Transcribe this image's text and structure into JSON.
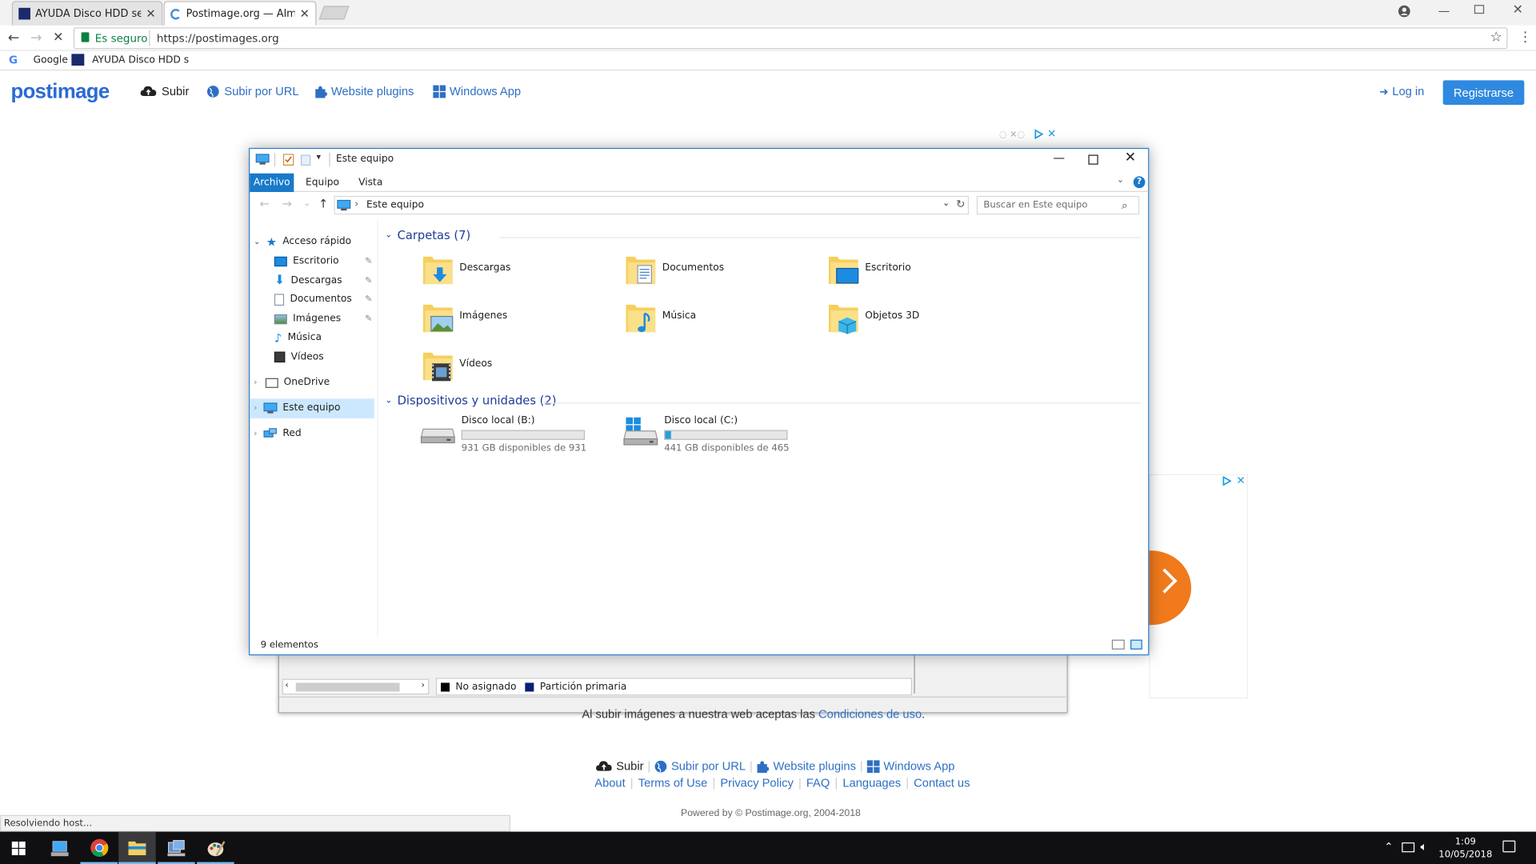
{
  "browser": {
    "tabs": [
      {
        "label": "AYUDA Disco HDD secun"
      },
      {
        "label": "Postimage.org — Almace"
      }
    ],
    "secure_label": "Es seguro",
    "url": "https://postimages.org",
    "bookmarks": [
      {
        "label": "Google"
      },
      {
        "label": "AYUDA Disco HDD s"
      }
    ],
    "status": "Resolviendo host..."
  },
  "site": {
    "logo": "postimage",
    "nav": [
      {
        "label": "Subir",
        "icon": "cloud-upload-icon"
      },
      {
        "label": "Subir por URL",
        "icon": "globe-icon"
      },
      {
        "label": "Website plugins",
        "icon": "puzzle-icon"
      },
      {
        "label": "Windows App",
        "icon": "windows-icon"
      }
    ],
    "login_label": "Log in",
    "register_label": "Registrarse",
    "terms_text": "Al subir imágenes a nuestra web aceptas las",
    "terms_link": "Condiciones de uso",
    "terms_end": ".",
    "footer_nav": [
      {
        "label": "Subir"
      },
      {
        "label": "Subir por URL"
      },
      {
        "label": "Website plugins"
      },
      {
        "label": "Windows App"
      }
    ],
    "footer_links": [
      {
        "label": "About"
      },
      {
        "label": "Terms of Use"
      },
      {
        "label": "Privacy Policy"
      },
      {
        "label": "FAQ"
      },
      {
        "label": "Languages"
      },
      {
        "label": "Contact us"
      }
    ],
    "powered": "Powered by © Postimage.org, 2004-2018"
  },
  "diskmgmt": {
    "legend": [
      {
        "label": "No asignado",
        "color": "#000000"
      },
      {
        "label": "Partición primaria",
        "color": "#0a1e78"
      }
    ]
  },
  "explorer": {
    "title": "Este equipo",
    "ribbon_tabs": [
      {
        "label": "Archivo"
      },
      {
        "label": "Equipo"
      },
      {
        "label": "Vista"
      }
    ],
    "address": "Este equipo",
    "search_placeholder": "Buscar en Este equipo",
    "nav": {
      "quick_access": "Acceso rápido",
      "pinned": [
        {
          "label": "Escritorio",
          "icon": "desktop-icon"
        },
        {
          "label": "Descargas",
          "icon": "download-icon"
        },
        {
          "label": "Documentos",
          "icon": "document-icon"
        },
        {
          "label": "Imágenes",
          "icon": "pictures-icon"
        },
        {
          "label": "Música",
          "icon": "music-icon"
        },
        {
          "label": "Vídeos",
          "icon": "video-icon"
        }
      ],
      "onedrive": "OneDrive",
      "this_pc": "Este equipo",
      "network": "Red"
    },
    "folders_header": "Carpetas (7)",
    "folders": [
      {
        "label": "Descargas",
        "icon": "downloads-folder-icon"
      },
      {
        "label": "Documentos",
        "icon": "documents-folder-icon"
      },
      {
        "label": "Escritorio",
        "icon": "desktop-folder-icon"
      },
      {
        "label": "Imágenes",
        "icon": "pictures-folder-icon"
      },
      {
        "label": "Música",
        "icon": "music-folder-icon"
      },
      {
        "label": "Objetos 3D",
        "icon": "3d-objects-folder-icon"
      },
      {
        "label": "Vídeos",
        "icon": "videos-folder-icon"
      }
    ],
    "devices_header": "Dispositivos y unidades (2)",
    "drives": [
      {
        "label": "Disco local (B:)",
        "free": "931 GB disponibles de 931",
        "used_fraction": 0.0
      },
      {
        "label": "Disco local (C:)",
        "free": "441 GB disponibles de 465",
        "used_fraction": 0.05
      }
    ],
    "status": "9 elementos"
  },
  "taskbar": {
    "time": "1:09",
    "date": "10/05/2018"
  },
  "colors": {
    "accent": "#1979ca",
    "site_link": "#2e6fc4",
    "register_btn": "#2f89e0",
    "explorer_header": "#1e3c96"
  }
}
